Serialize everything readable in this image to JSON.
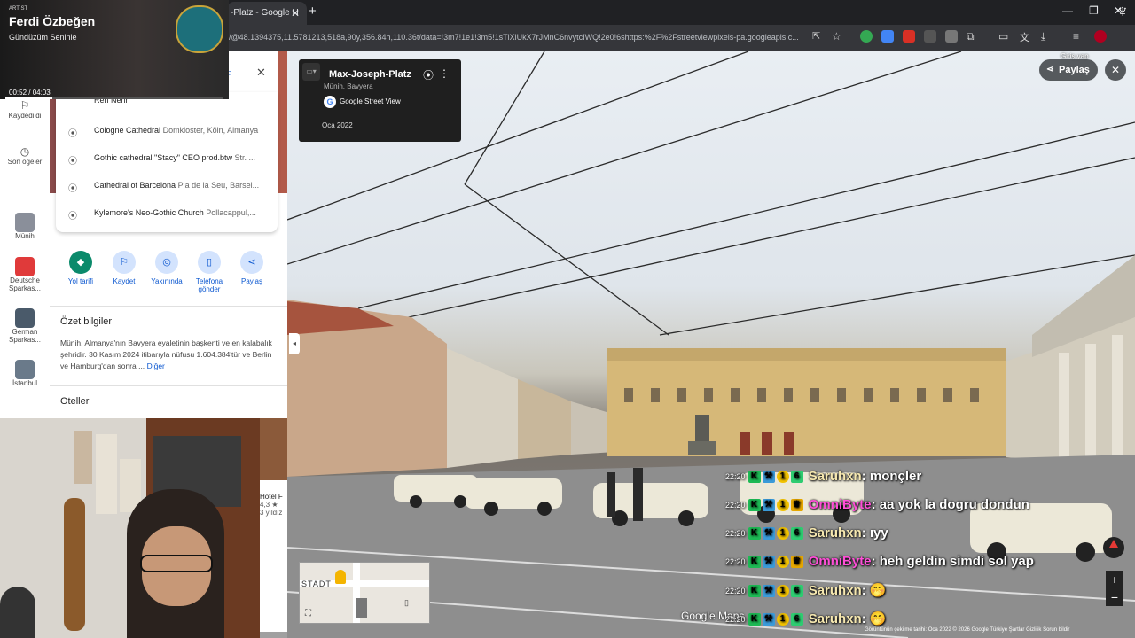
{
  "browser": {
    "tab_title": "-Platz - Google H",
    "url": "/@48.1394375,11.5781213,518a,90y,356.84h,110.36t/data=!3m7!1e1!3m5!1sTlXiUkX7rJMnC6nvytcIWQ!2e0!6shttps:%2F%2Fstreetviewpixels-pa.googleapis.c..."
  },
  "now_playing": {
    "label": "ARTIST",
    "artist": "Ferdi Özbeğen",
    "song": "Gündüzüm Seninle",
    "time": "00:52 / 04:03"
  },
  "rail": {
    "saved": "Kaydedildi",
    "recent": "Son öğeler",
    "items": [
      "Münih",
      "Deutsche Sparkas...",
      "German Sparkas...",
      "İstanbul"
    ]
  },
  "results": [
    {
      "title": "Ren Nehri",
      "sub": ""
    },
    {
      "title": "Cologne Cathedral",
      "sub": "Domkloster, Köln, Almanya"
    },
    {
      "title": "Gothic cathedral \"Stacy\" CEO prod.btw",
      "sub": "Str. ..."
    },
    {
      "title": "Cathedral of Barcelona",
      "sub": "Pla de la Seu, Barsel..."
    },
    {
      "title": "Kylemore's Neo-Gothic Church",
      "sub": "Pollacappul,..."
    }
  ],
  "actions": [
    "Yol tarifi",
    "Kaydet",
    "Yakınında",
    "Telefona gönder",
    "Paylaş"
  ],
  "summary": {
    "heading": "Özet bilgiler",
    "text": "Münih, Almanya'nın Bavyera eyaletinin başkenti ve en kalabalık şehridir. 30 Kasım 2024 itibarıyla nüfusu 1.604.384'tür ve Berlin ve Hamburg'dan sonra ...",
    "more": "Diğer"
  },
  "hotels": {
    "heading": "Oteller",
    "name": "Hotel F",
    "rating": "4,3 ★",
    "years": "3 yıldız"
  },
  "streetview": {
    "place": "Max-Joseph-Platz",
    "region": "Münih, Bavyera",
    "source": "Google Street View",
    "date": "Oca 2022",
    "share": "Paylaş",
    "logo": "Google Maps",
    "minimap_label": "STADT",
    "footer": "Görüntünün çekilme tarihi: Oca 2022   © 2026 Google   Türkiye   Şartlar   Gizlilik   Sorun bildir",
    "account": "Giriş yap"
  },
  "chat": [
    {
      "time": "22:20",
      "user": "Saruhxn",
      "color": "#f6e8b0",
      "msg": ": monçler"
    },
    {
      "time": "22:20",
      "user": "OmniByte",
      "color": "#ff4fd8",
      "msg": ": aa yok la dogru dondun"
    },
    {
      "time": "22:20",
      "user": "Saruhxn",
      "color": "#f6e8b0",
      "msg": ": ıyy"
    },
    {
      "time": "22:20",
      "user": "OmniByte",
      "color": "#ff4fd8",
      "msg": ": heh geldin simdi sol yap"
    },
    {
      "time": "22:20",
      "user": "Saruhxn",
      "color": "#f6e8b0",
      "msg": ": 🤭"
    },
    {
      "time": "22:20",
      "user": "Saruhxn",
      "color": "#f6e8b0",
      "msg": ": 🤭"
    }
  ]
}
